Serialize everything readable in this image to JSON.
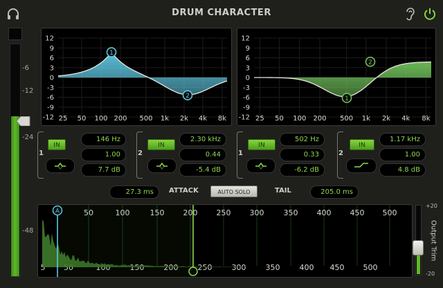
{
  "title": "DRUM CHARACTER",
  "meter": {
    "labels": [
      "-6",
      "-12",
      "-24",
      "-48"
    ]
  },
  "eq_left": {
    "y_labels": [
      "12",
      "9",
      "6",
      "3",
      "0",
      "-3",
      "-6",
      "-9",
      "-12"
    ],
    "x_labels": [
      "25",
      "50",
      "100",
      "200",
      "500",
      "1k",
      "2k",
      "4k",
      "8k"
    ],
    "nodes": [
      "1",
      "2"
    ],
    "band1": {
      "num": "1",
      "in_label": "IN",
      "freq": "146 Hz",
      "q": "1.00",
      "gain": "7.7 dB"
    },
    "band2": {
      "num": "2",
      "in_label": "IN",
      "freq": "2.30 kHz",
      "q": "0.44",
      "gain": "-5.4 dB"
    }
  },
  "eq_right": {
    "y_labels": [
      "12",
      "9",
      "6",
      "3",
      "0",
      "-3",
      "-6",
      "-9",
      "-12"
    ],
    "x_labels": [
      "25",
      "50",
      "100",
      "200",
      "500",
      "1k",
      "2k",
      "4k",
      "8k"
    ],
    "nodes": [
      "1",
      "2"
    ],
    "band1": {
      "num": "1",
      "in_label": "IN",
      "freq": "502 Hz",
      "q": "0.33",
      "gain": "-6.2 dB"
    },
    "band2": {
      "num": "2",
      "in_label": "IN",
      "freq": "1.17 kHz",
      "q": "1.00",
      "gain": "4.8 dB"
    }
  },
  "attack": {
    "label": "ATTACK",
    "value": "27.3 ms"
  },
  "auto_solo": "AUTO SOLO",
  "tail": {
    "label": "TAIL",
    "value": "205.0 ms"
  },
  "timeline": {
    "top_labels": [
      "50",
      "100",
      "150",
      "200",
      "250",
      "300",
      "350",
      "400",
      "450",
      "500"
    ],
    "bottom_labels": [
      "5",
      "50",
      "100",
      "150",
      "200",
      "250",
      "300",
      "350",
      "400",
      "450",
      "500"
    ],
    "marker_a": "A"
  },
  "output_trim": {
    "label": "Output Trim",
    "max": "+20",
    "min": "-20"
  },
  "colors": {
    "accent": "#8fd64d",
    "blue": "#5fc6e0",
    "green": "#6fbf5a"
  }
}
